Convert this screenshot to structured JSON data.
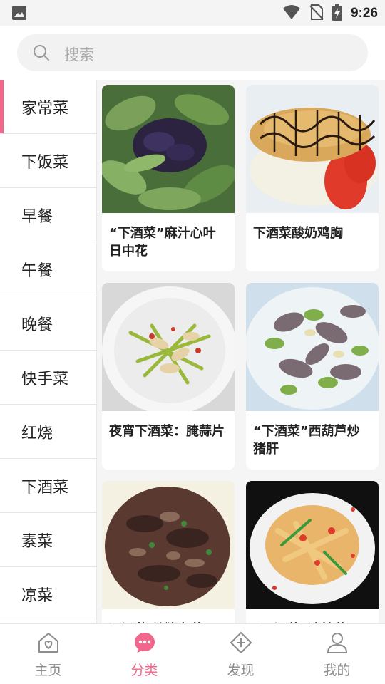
{
  "status": {
    "time": "9:26"
  },
  "search": {
    "placeholder": "搜索"
  },
  "sidebar": {
    "items": [
      {
        "label": "家常菜",
        "active": true
      },
      {
        "label": "下饭菜"
      },
      {
        "label": "早餐"
      },
      {
        "label": "午餐"
      },
      {
        "label": "晚餐"
      },
      {
        "label": "快手菜"
      },
      {
        "label": "红烧"
      },
      {
        "label": "下酒菜"
      },
      {
        "label": "素菜"
      },
      {
        "label": "凉菜"
      }
    ]
  },
  "recipes": [
    {
      "title": "“下酒菜”麻汁心叶日中花"
    },
    {
      "title": "下酒菜酸奶鸡胸"
    },
    {
      "title": "夜宵下酒菜：腌蒜片"
    },
    {
      "title": "“下酒菜”西葫芦炒猪肝"
    },
    {
      "title": "下酒菜 炒猪杂菜"
    },
    {
      "title": "“下酒菜”凉拌菜"
    }
  ],
  "tabs": [
    {
      "label": "主页",
      "icon": "home-icon"
    },
    {
      "label": "分类",
      "icon": "category-icon",
      "active": true
    },
    {
      "label": "发现",
      "icon": "discover-icon"
    },
    {
      "label": "我的",
      "icon": "profile-icon"
    }
  ],
  "colors": {
    "accent": "#f2668b",
    "tab_inactive": "#8d8d8d"
  }
}
